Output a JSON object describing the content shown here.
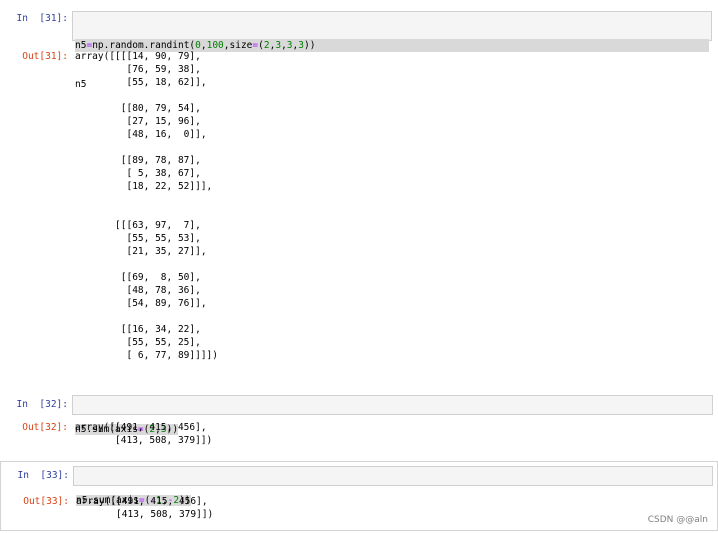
{
  "cells": [
    {
      "in_prompt": "In  [31]:",
      "out_prompt": "Out[31]:",
      "code": {
        "var1": "n5",
        "op1": "=",
        "mid1": "np.random.randint(",
        "n1": "0",
        "c1": ",",
        "n2": "100",
        "c2": ",size",
        "op2": "=",
        "p1": "(",
        "n3": "2",
        "c3": ",",
        "n4": "3",
        "c4": ",",
        "n5": "3",
        "c5": ",",
        "n6": "3",
        "p2": "))",
        "line2": "n5"
      },
      "output": "array([[[[14, 90, 79],\n         [76, 59, 38],\n         [55, 18, 62]],\n\n        [[80, 79, 54],\n         [27, 15, 96],\n         [48, 16,  0]],\n\n        [[89, 78, 87],\n         [ 5, 38, 67],\n         [18, 22, 52]]],\n\n\n       [[[63, 97,  7],\n         [55, 55, 53],\n         [21, 35, 27]],\n\n        [[69,  8, 50],\n         [48, 78, 36],\n         [54, 89, 76]],\n\n        [[16, 34, 22],\n         [55, 55, 25],\n         [ 6, 77, 89]]]])"
    },
    {
      "in_prompt": "In  [32]:",
      "out_prompt": "Out[32]:",
      "code": {
        "pre": "n5.sum(axis",
        "op": "=",
        "p1": "(",
        "n1": "2",
        "c1": ",",
        "n2": "3",
        "p2": "))"
      },
      "output": "array([[491, 415, 456],\n       [413, 508, 379]])"
    },
    {
      "in_prompt": "In  [33]:",
      "out_prompt": "Out[33]:",
      "code": {
        "pre": "n5.sum(axis",
        "op": "=",
        "p1": "(",
        "m1": "-",
        "n1": "1",
        "c1": ",",
        "m2": "-",
        "n2": "2",
        "p2": "))"
      },
      "output": "array([[491, 415, 456],\n       [413, 508, 379]])"
    }
  ],
  "watermark": "CSDN @@aln"
}
